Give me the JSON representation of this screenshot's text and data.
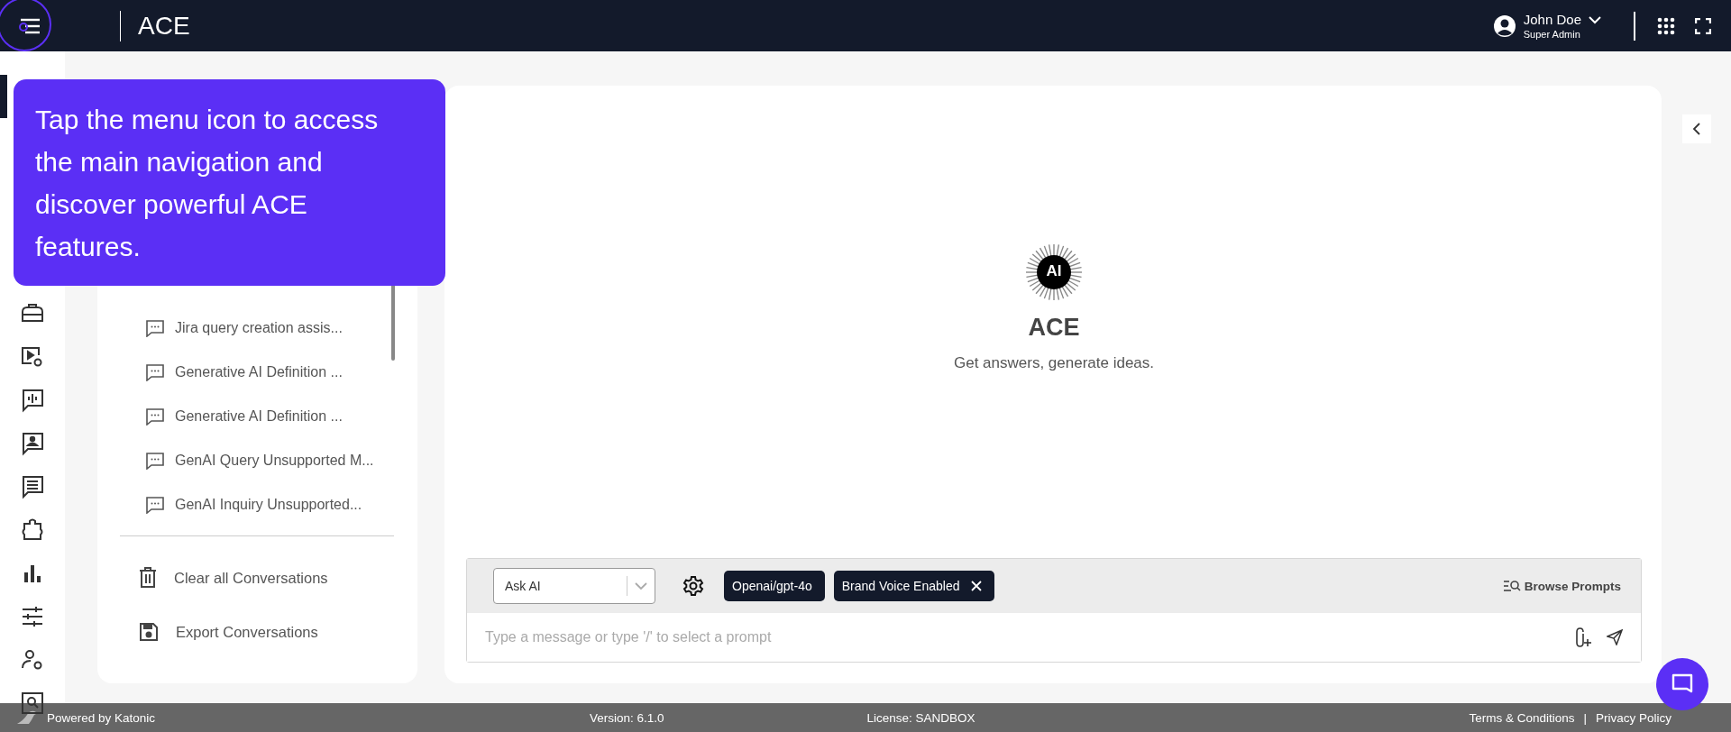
{
  "header": {
    "title": "ACE",
    "user": {
      "name": "John Doe",
      "role": "Super Admin"
    }
  },
  "nav_rail": [
    {
      "selected": true
    },
    {
      "selected": false
    },
    {
      "selected": false
    },
    {
      "selected": false
    },
    {
      "selected": false
    },
    {
      "selected": false
    },
    {
      "selected": false
    },
    {
      "selected": false
    },
    {
      "selected": false
    },
    {
      "selected": false
    },
    {
      "selected": false
    }
  ],
  "tour_tooltip": {
    "text": "Tap the menu icon to access the main navigation and discover powerful ACE features."
  },
  "conversations": [
    "Jira query creation assis...",
    "Generative AI Definition ...",
    "Generative AI Definition ...",
    "GenAI Query Unsupported M...",
    "GenAI Inquiry Unsupported..."
  ],
  "conversation_actions": [
    {
      "kind": "clear",
      "label": "Clear all Conversations"
    },
    {
      "kind": "export",
      "label": "Export Conversations"
    }
  ],
  "hero": {
    "badge": "AI",
    "title": "ACE",
    "subtitle": "Get answers, generate ideas."
  },
  "composer": {
    "mode": "Ask AI",
    "chips": [
      {
        "label": "Openai/gpt-4o",
        "removable": false
      },
      {
        "label": "Brand Voice Enabled",
        "removable": true
      }
    ],
    "browse": "Browse Prompts",
    "placeholder": "Type a message or type '/' to select a prompt"
  },
  "footer": {
    "powered_by": "Powered by Katonic",
    "version": "Version: 6.1.0",
    "license": "License: SANDBOX",
    "links": [
      "Terms & Conditions",
      "Privacy Policy"
    ],
    "separator": "|"
  }
}
